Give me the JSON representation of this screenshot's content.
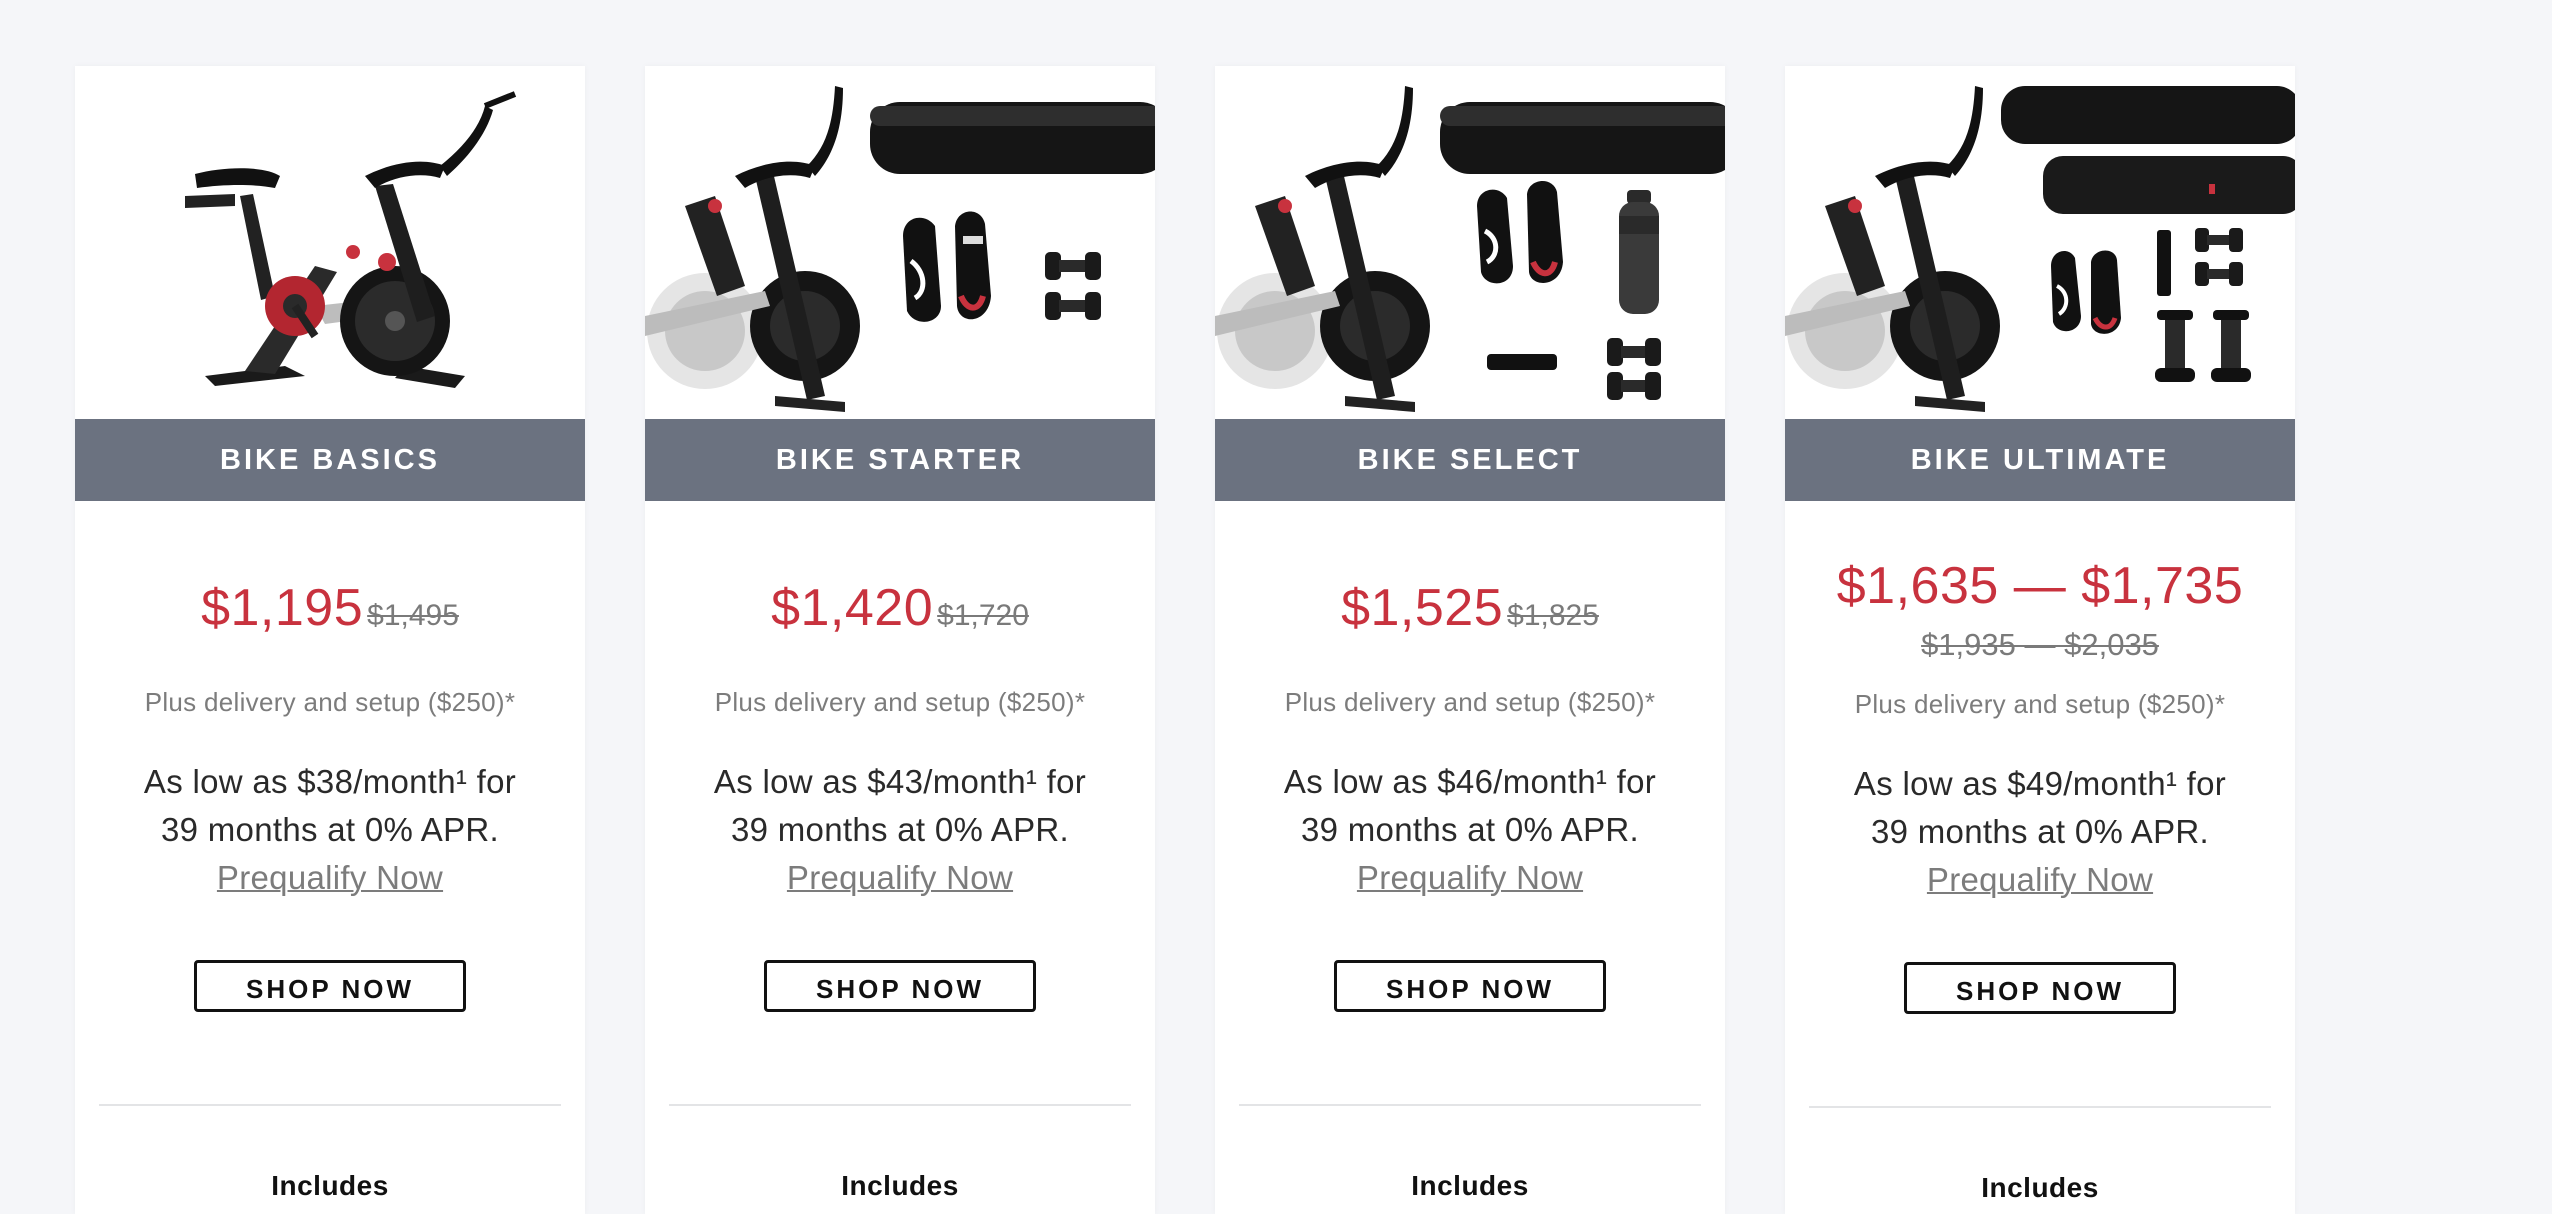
{
  "cards": [
    {
      "name": "BIKE BASICS",
      "price": "$1,195",
      "original_price": "$1,495",
      "delivery": "Plus delivery and setup ($250)*",
      "finance_line1": "As low as $38/month¹ for",
      "finance_line2": "39 months at 0% APR.",
      "prequalify": "Prequalify Now",
      "shop": "SHOP NOW",
      "includes": "Includes"
    },
    {
      "name": "BIKE STARTER",
      "price": "$1,420",
      "original_price": "$1,720",
      "delivery": "Plus delivery and setup ($250)*",
      "finance_line1": "As low as $43/month¹ for",
      "finance_line2": "39 months at 0% APR.",
      "prequalify": "Prequalify Now",
      "shop": "SHOP NOW",
      "includes": "Includes"
    },
    {
      "name": "BIKE SELECT",
      "price": "$1,525",
      "original_price": "$1,825",
      "delivery": "Plus delivery and setup ($250)*",
      "finance_line1": "As low as $46/month¹ for",
      "finance_line2": "39 months at 0% APR.",
      "prequalify": "Prequalify Now",
      "shop": "SHOP NOW",
      "includes": "Includes"
    },
    {
      "name": "BIKE ULTIMATE",
      "price": "$1,635 — $1,735",
      "original_price": "$1,935 — $2,035",
      "delivery": "Plus delivery and setup ($250)*",
      "finance_line1": "As low as $49/month¹ for",
      "finance_line2": "39 months at 0% APR.",
      "prequalify": "Prequalify Now",
      "shop": "SHOP NOW",
      "includes": "Includes"
    }
  ],
  "colors": {
    "band": "#6b7280",
    "price": "#c8323e",
    "background": "#f5f6f9"
  },
  "icons": [
    "bike-icon",
    "foam-roller-icon",
    "cycling-shoes-icon",
    "dumbbells-icon",
    "water-bottle-icon",
    "heart-rate-monitor-icon",
    "dumbbell-stands-icon"
  ]
}
